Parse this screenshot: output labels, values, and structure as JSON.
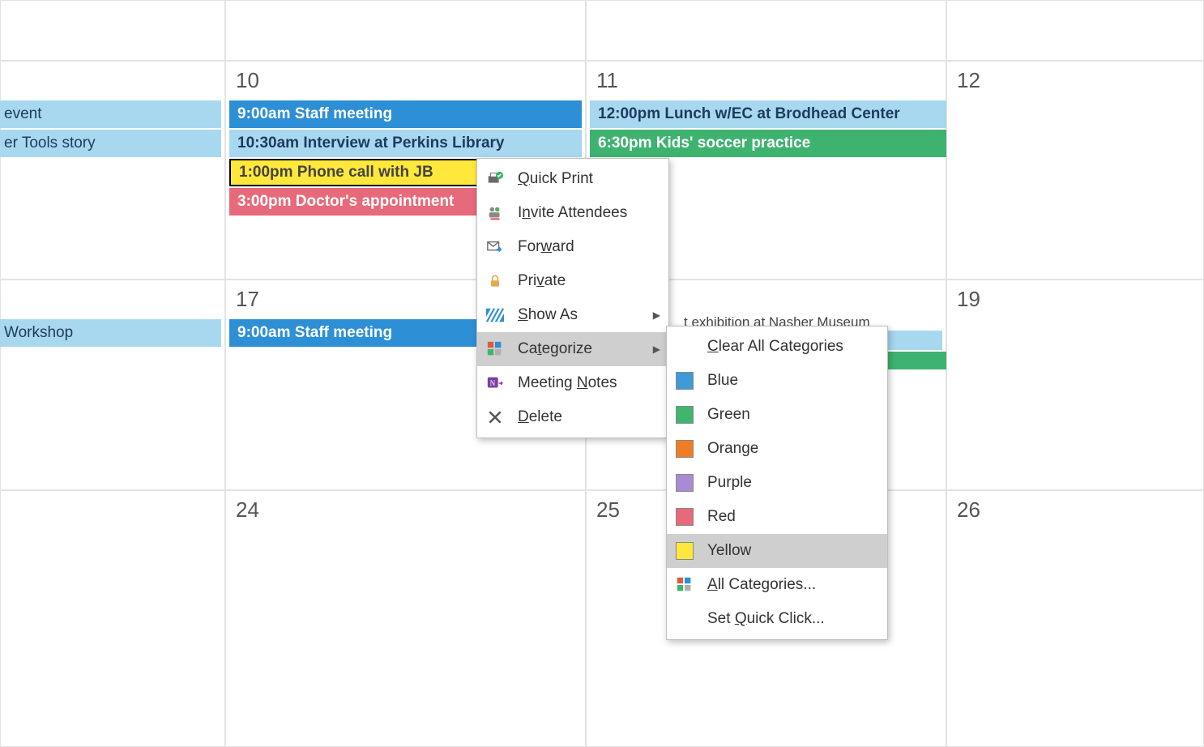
{
  "calendar": {
    "headers": [
      "",
      "",
      "",
      ""
    ],
    "rows": [
      {
        "cells": [
          {
            "day": "",
            "events": [
              {
                "label": "event",
                "color": "lightblue"
              },
              {
                "label": "er Tools story",
                "color": "lightblue"
              }
            ]
          },
          {
            "day": "10",
            "events": [
              {
                "label": "9:00am Staff meeting",
                "color": "blue",
                "bold": true
              },
              {
                "label": "10:30am Interview at Perkins Library",
                "color": "lightblue",
                "bold": true
              },
              {
                "label": "1:00pm Phone call with JB",
                "color": "yellow",
                "bold": true,
                "selected": true
              },
              {
                "label": "3:00pm Doctor's appointment",
                "color": "red",
                "bold": true
              }
            ]
          },
          {
            "day": "11",
            "events": [
              {
                "label": "12:00pm Lunch w/EC at Brodhead Center",
                "color": "lightblue",
                "bold": true
              },
              {
                "label": "6:30pm Kids' soccer practice",
                "color": "green",
                "bold": true
              }
            ]
          },
          {
            "day": "12",
            "events": []
          }
        ]
      },
      {
        "cells": [
          {
            "day": "",
            "events": [
              {
                "label": "Workshop",
                "color": "lightblue"
              }
            ]
          },
          {
            "day": "17",
            "events": [
              {
                "label": "9:00am Staff meeting",
                "color": "blue",
                "bold": true
              }
            ]
          },
          {
            "day": "",
            "obscured_label": "t exhibition at Nasher Museum",
            "events": [
              {
                "label": "",
                "color": "lightblue",
                "hidden": true
              },
              {
                "label": "",
                "color": "green",
                "hidden": true
              }
            ]
          },
          {
            "day": "19",
            "events": []
          }
        ]
      },
      {
        "cells": [
          {
            "day": "",
            "events": []
          },
          {
            "day": "24",
            "events": []
          },
          {
            "day": "25",
            "events": []
          },
          {
            "day": "26",
            "events": []
          }
        ]
      }
    ]
  },
  "context_menu": {
    "items": [
      {
        "label": "Quick Print",
        "underline_index": 0,
        "icon": "printer-check-icon"
      },
      {
        "label": "Invite Attendees",
        "underline_index": 1,
        "icon": "attendees-icon"
      },
      {
        "label": "Forward",
        "underline_index": 3,
        "icon": "forward-icon"
      },
      {
        "label": "Private",
        "underline_index": 3,
        "icon": "lock-icon"
      },
      {
        "label": "Show As",
        "underline_index": 0,
        "icon": "busy-icon",
        "submenu": true
      },
      {
        "label": "Categorize",
        "underline_index": 2,
        "icon": "categories-icon",
        "submenu": true,
        "selected": true
      },
      {
        "label": "Meeting Notes",
        "underline_index": 8,
        "icon": "onenote-icon"
      },
      {
        "label": "Delete",
        "underline_index": 0,
        "icon": "delete-icon"
      }
    ],
    "submenu": {
      "items": [
        {
          "label": "Clear All Categories",
          "underline_index": 0,
          "icon": null
        },
        {
          "label": "Blue",
          "swatch": "blue"
        },
        {
          "label": "Green",
          "swatch": "green"
        },
        {
          "label": "Orange",
          "swatch": "orange"
        },
        {
          "label": "Purple",
          "swatch": "purple"
        },
        {
          "label": "Red",
          "swatch": "red"
        },
        {
          "label": "Yellow",
          "swatch": "yellow",
          "selected": true
        },
        {
          "label": "All Categories...",
          "underline_index": 0,
          "icon": "categories-icon"
        },
        {
          "label": "Set Quick Click...",
          "underline_index": 4,
          "icon": null
        }
      ]
    }
  }
}
